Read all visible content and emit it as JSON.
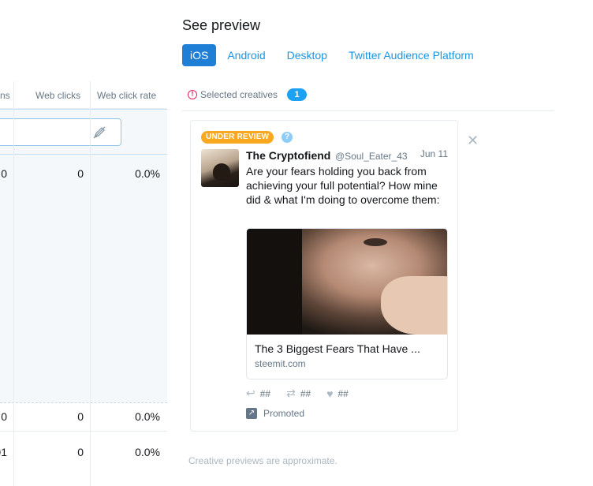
{
  "table": {
    "headers": {
      "clips": "ns",
      "web_clicks": "Web clicks",
      "web_click_rate": "Web click rate"
    },
    "rows": [
      {
        "clips": "0",
        "web_clicks": "0",
        "web_click_rate": "0.0%"
      },
      {
        "clips": "0",
        "web_clicks": "0",
        "web_click_rate": "0.0%"
      },
      {
        "clips": "01",
        "web_clicks": "0",
        "web_click_rate": "0.0%"
      }
    ]
  },
  "preview": {
    "title": "See preview",
    "tabs": [
      {
        "label": "iOS",
        "active": true
      },
      {
        "label": "Android",
        "active": false
      },
      {
        "label": "Desktop",
        "active": false
      },
      {
        "label": "Twitter Audience Platform",
        "active": false
      }
    ],
    "selected_label": "Selected creatives",
    "selected_count": "1",
    "footnote": "Creative previews are approximate."
  },
  "tweet": {
    "status_badge": "UNDER REVIEW",
    "help_glyph": "?",
    "name": "The Cryptofiend",
    "handle": "@Soul_Eater_43",
    "date": "Jun 11",
    "text": "Are your fears holding you back from achieving your full potential? How mine did & what I'm doing to overcome them:",
    "link_title": "The 3 Biggest Fears That Have ...",
    "link_domain": "steemit.com",
    "reply_count": "##",
    "retweet_count": "##",
    "like_count": "##",
    "promoted_label": "Promoted"
  },
  "icons": {
    "warning": "alert-circle-icon",
    "help": "question-icon",
    "reply": "reply-icon",
    "retweet": "retweet-icon",
    "like": "heart-icon",
    "promoted": "promoted-arrow-icon",
    "close": "close-icon",
    "edit": "edit-pen-icon"
  },
  "colors": {
    "accent": "#1f7ed6",
    "link": "#1b95e0",
    "badge_review": "#f9a820",
    "warning": "#e0245e"
  }
}
